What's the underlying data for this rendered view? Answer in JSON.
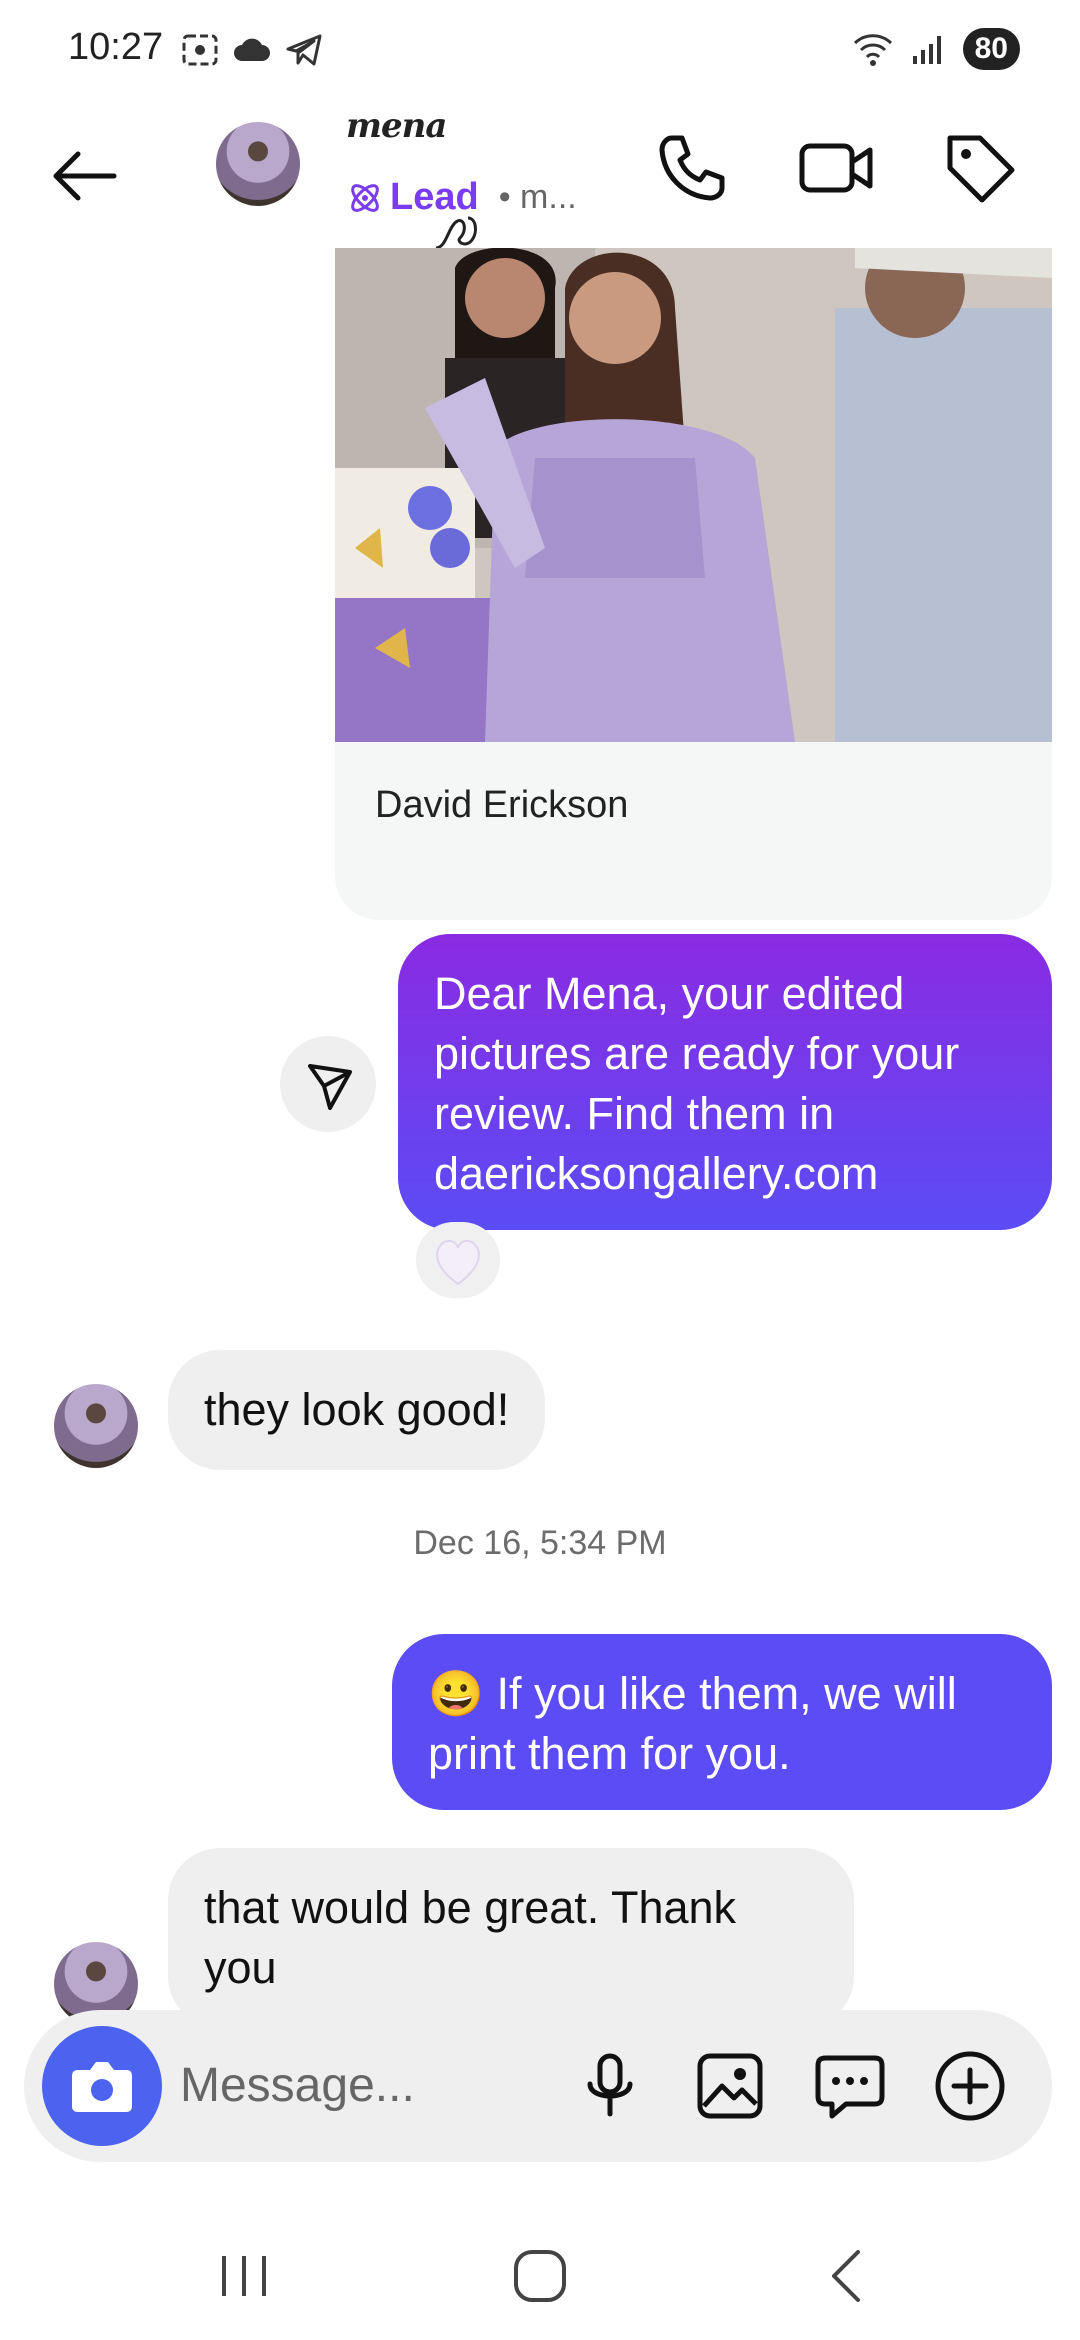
{
  "status_bar": {
    "time": "10:27",
    "battery": "80"
  },
  "header": {
    "brand": "mena",
    "label": "Lead",
    "subtitle": "• m..."
  },
  "photo_card": {
    "name": "David Erickson"
  },
  "messages": [
    {
      "from": "me",
      "text": "Dear Mena, your edited pictures are ready for your review.  Find them in daericksongallery.com"
    },
    {
      "from": "them",
      "text": "they look good!"
    },
    {
      "from": "me",
      "emoji": "😀",
      "text": " If you like them, we will print them for you."
    },
    {
      "from": "them",
      "text": "that would be great. Thank you"
    }
  ],
  "timestamp": "Dec 16, 5:34 PM",
  "composer": {
    "placeholder": "Message..."
  },
  "colors": {
    "accent": "#7a3cf0",
    "bubble_top": "#8a2be2",
    "bubble_bottom": "#5b4cf5",
    "camera": "#4b63ee"
  }
}
